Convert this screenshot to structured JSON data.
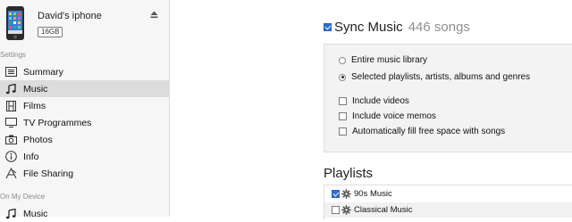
{
  "device": {
    "name": "David's iphone",
    "capacity": "16GB",
    "icon": "iphone-icon",
    "eject_icon": "eject-icon"
  },
  "sidebar": {
    "settings_label": "Settings",
    "items": [
      {
        "label": "Summary",
        "icon": "summary-icon"
      },
      {
        "label": "Music",
        "icon": "music-note-icon"
      },
      {
        "label": "Films",
        "icon": "film-icon"
      },
      {
        "label": "TV Programmes",
        "icon": "tv-icon"
      },
      {
        "label": "Photos",
        "icon": "camera-icon"
      },
      {
        "label": "Info",
        "icon": "info-icon"
      },
      {
        "label": "File Sharing",
        "icon": "file-sharing-icon"
      }
    ],
    "selected": "Music",
    "on_device_label": "On My Device",
    "on_device_items": [
      {
        "label": "Music",
        "icon": "music-note-icon"
      }
    ]
  },
  "main": {
    "sync": {
      "label": "Sync Music",
      "count": "446 songs",
      "checked": true
    },
    "options": {
      "radio": [
        {
          "label": "Entire music library",
          "selected": false
        },
        {
          "label": "Selected playlists, artists, albums and genres",
          "selected": true
        }
      ],
      "checkboxes": [
        {
          "label": "Include videos",
          "checked": false
        },
        {
          "label": "Include voice memos",
          "checked": false
        },
        {
          "label": "Automatically fill free space with songs",
          "checked": false
        }
      ]
    },
    "playlists": {
      "heading": "Playlists",
      "items": [
        {
          "label": "90s Music",
          "checked": true,
          "icon": "smart-playlist-gear-icon"
        },
        {
          "label": "Classical Music",
          "checked": false,
          "icon": "smart-playlist-gear-icon"
        }
      ]
    }
  },
  "colors": {
    "accent": "#2f6fd1",
    "sidebar_bg": "#f6f6f6",
    "selected_bg": "#dcdcdc",
    "panel_bg": "#f3f3f3"
  }
}
